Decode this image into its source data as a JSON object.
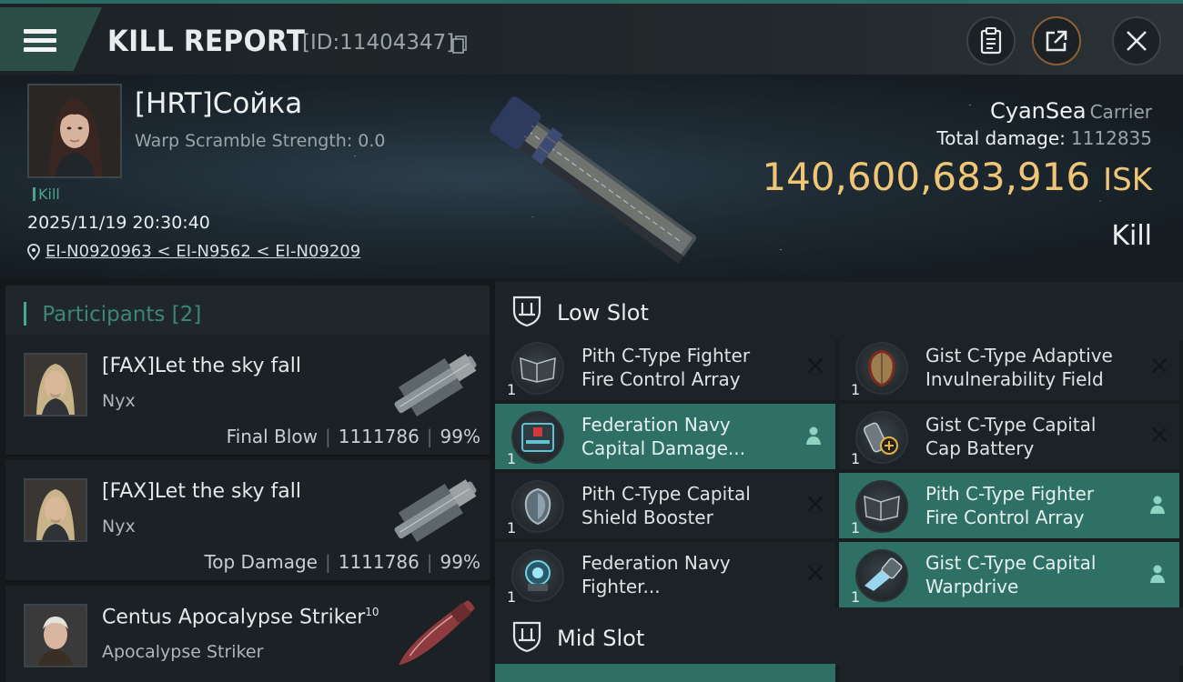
{
  "topbar": {
    "title": "KILL REPORT",
    "report_id": "[ID:11404347]",
    "icons": [
      "menu-icon",
      "copy-icon",
      "clipboard-icon",
      "share-icon",
      "close-icon"
    ]
  },
  "victim": {
    "name": "[HRT]Сойка",
    "warp_scramble": "Warp Scramble Strength: 0.0",
    "kill_tag": "Kill",
    "datetime": "2025/11/19 20:30:40",
    "location": "EI-N0920963 < EI-N9562 < EI-N09209",
    "corp": "CyanSea",
    "ship_class": "Carrier",
    "total_damage_label": "Total damage:",
    "total_damage_value": "1112835",
    "isk_value": "140,600,683,916",
    "isk_unit": "ISK",
    "result": "Kill"
  },
  "participants": {
    "title": "Participants",
    "count": "[2]",
    "rows": [
      {
        "name": "[FAX]Let the sky fall",
        "sup": "",
        "ship": "Nyx",
        "role": "Final Blow",
        "damage": "1111786",
        "percent": "99%"
      },
      {
        "name": "[FAX]Let the sky fall",
        "sup": "",
        "ship": "Nyx",
        "role": "Top Damage",
        "damage": "1111786",
        "percent": "99%"
      },
      {
        "name": "Centus Apocalypse Striker",
        "sup": "10",
        "ship": "Apocalypse Striker",
        "role": "",
        "damage": "",
        "percent": ""
      }
    ]
  },
  "modules": {
    "low_slot_label": "Low Slot",
    "mid_slot_label": "Mid Slot",
    "low": [
      {
        "line1": "Pith C-Type Fighter",
        "line2": "Fire Control Array",
        "qty": "1",
        "state": "destroyed",
        "selected": false
      },
      {
        "line1": "Gist C-Type Adaptive",
        "line2": "Invulnerability Field",
        "qty": "1",
        "state": "destroyed",
        "selected": false
      },
      {
        "line1": "Federation Navy",
        "line2": "Capital Damage...",
        "qty": "1",
        "state": "dropped",
        "selected": true
      },
      {
        "line1": "Gist C-Type Capital",
        "line2": "Cap Battery",
        "qty": "1",
        "state": "destroyed",
        "selected": false
      },
      {
        "line1": "Pith C-Type Capital",
        "line2": "Shield Booster",
        "qty": "1",
        "state": "destroyed",
        "selected": false
      },
      {
        "line1": "Pith C-Type Fighter",
        "line2": "Fire Control Array",
        "qty": "1",
        "state": "dropped",
        "selected": true
      },
      {
        "line1": "Federation Navy",
        "line2": "Fighter...",
        "qty": "1",
        "state": "destroyed",
        "selected": false
      },
      {
        "line1": "Gist C-Type Capital",
        "line2": "Warpdrive",
        "qty": "1",
        "state": "dropped",
        "selected": true
      }
    ]
  },
  "colors": {
    "accent_teal": "#2f7066",
    "isk_gold": "#f0c676",
    "tag_green": "#48a58f"
  }
}
